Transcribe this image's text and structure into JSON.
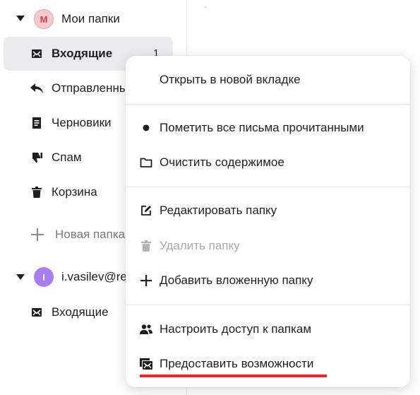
{
  "sidebar": {
    "group1": {
      "avatar_letter": "М",
      "title": "Мои папки",
      "items": [
        {
          "icon": "envelope-icon",
          "label": "Входящие",
          "count": "1",
          "selected": true
        },
        {
          "icon": "reply-icon",
          "label": "Отправленные"
        },
        {
          "icon": "document-icon",
          "label": "Черновики"
        },
        {
          "icon": "thumbs-down-icon",
          "label": "Спам"
        },
        {
          "icon": "trash-icon",
          "label": "Корзина"
        }
      ],
      "new_folder_label": "Новая папка"
    },
    "group2": {
      "avatar_letter": "I",
      "title": "i.vasilev@re",
      "items": [
        {
          "icon": "envelope-icon",
          "label": "Входящие"
        }
      ]
    }
  },
  "context_menu": {
    "items": [
      {
        "icon": "",
        "label": "Открыть в новой вкладке"
      },
      {
        "icon": "dot-icon",
        "label": "Пометить все письма прочитанными"
      },
      {
        "icon": "folder-icon",
        "label": "Очистить содержимое"
      },
      {
        "icon": "edit-icon",
        "label": "Редактировать папку"
      },
      {
        "icon": "trash-icon",
        "label": "Удалить папку",
        "disabled": true
      },
      {
        "icon": "plus-icon",
        "label": "Добавить вложенную папку"
      },
      {
        "icon": "people-icon",
        "label": "Настроить доступ к папкам"
      },
      {
        "icon": "shared-mail-icon",
        "label": "Предоставить возможности"
      }
    ]
  },
  "colors": {
    "highlight_underline": "#f2222b",
    "selected_bg": "#ececef",
    "avatar_m_bg": "#f6c9cd",
    "avatar_i_bg": "#a97ef2"
  }
}
